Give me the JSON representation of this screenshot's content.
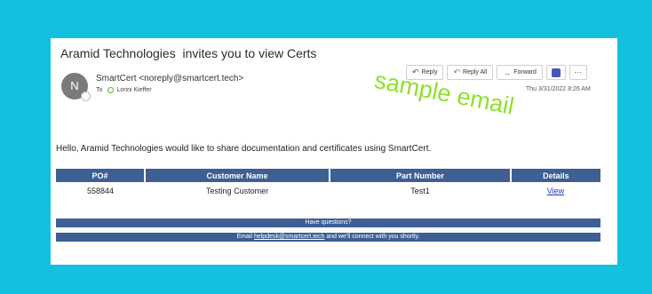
{
  "email": {
    "subject": "Aramid Technologies  invites you to view Certs",
    "avatar_initial": "N",
    "sender": "SmartCert <noreply@smartcert.tech>",
    "to_label": "To",
    "recipient": "Lonni Kieffer",
    "timestamp": "Thu 3/31/2022 8:26 AM",
    "greeting": "Hello, Aramid Technologies would like to share documentation and certificates using SmartCert."
  },
  "toolbar": {
    "reply_label": "Reply",
    "reply_all_label": "Reply All",
    "forward_label": "Forward",
    "more_label": "···"
  },
  "watermark": "sample email",
  "table": {
    "headers": [
      "PO#",
      "Customer Name",
      "Part Number",
      "Details"
    ],
    "rows": [
      {
        "po": "558844",
        "customer": "Testing Customer",
        "part": "Test1",
        "details": "View"
      }
    ]
  },
  "footer": {
    "questions": "Have questions?",
    "email_prefix": "Email ",
    "email_link": "helpdesk@smartcert.tech",
    "email_suffix": " and we'll connect with you shortly."
  },
  "colors": {
    "background": "#13c0e0",
    "header_blue": "#3d5f93",
    "watermark_green": "#8fe02c",
    "link_blue": "#1a3ec7"
  }
}
